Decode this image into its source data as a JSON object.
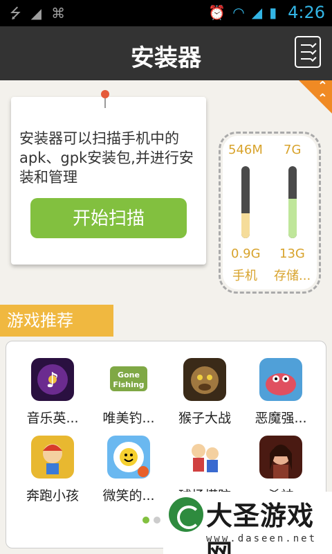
{
  "status_bar": {
    "left_icons": [
      "usb-icon",
      "pocket-icon",
      "android-icon"
    ],
    "right_icons": [
      "alarm-icon",
      "wifi-icon",
      "signal-icon",
      "battery-icon"
    ],
    "time": "4:26"
  },
  "app_bar": {
    "title": "安装器",
    "manage_icon": "checklist-icon"
  },
  "intro": {
    "text": "安装器可以扫描手机中的apk、gpk安装包,并进行安装和管理",
    "scan_button": "开始扫描"
  },
  "storage": {
    "phone": {
      "used": "546M",
      "total": "0.9G",
      "label": "手机",
      "fill_fraction": 0.35,
      "color": "#f5dc9a"
    },
    "sd": {
      "used": "7G",
      "total": "13G",
      "label": "存储...",
      "fill_fraction": 0.55,
      "color": "#bfe69a"
    }
  },
  "section": {
    "title": "游戏推荐"
  },
  "games": [
    {
      "name": "音乐英...",
      "icon": "music-hero-icon",
      "color": "#6b2b8f"
    },
    {
      "name": "唯美钓...",
      "icon": "gone-fishing-icon",
      "color": "#7fa845"
    },
    {
      "name": "猴子大战",
      "icon": "monkey-war-icon",
      "color": "#7a5a2a"
    },
    {
      "name": "恶魔强...",
      "icon": "crab-monster-icon",
      "color": "#e05060"
    },
    {
      "name": "奔跑小孩",
      "icon": "running-kid-icon",
      "color": "#e8b830"
    },
    {
      "name": "微笑的...",
      "icon": "smiling-flower-icon",
      "color": "#4aa0e0"
    },
    {
      "name": "球场塔防",
      "icon": "stadium-defense-icon",
      "color": "#d04040"
    },
    {
      "name": "杀神",
      "icon": "warrior-girl-icon",
      "color": "#8a3a2a"
    }
  ],
  "pager": {
    "active": 0,
    "count": 2
  },
  "watermark": {
    "title": "大圣游戏网",
    "url": "www.daseen.net"
  }
}
